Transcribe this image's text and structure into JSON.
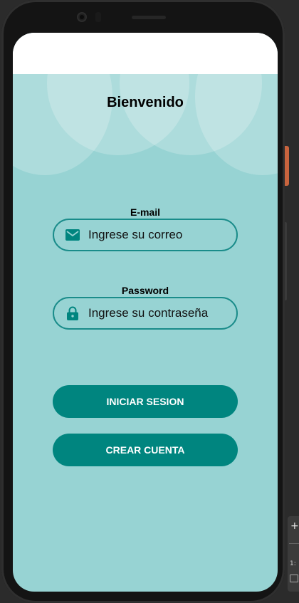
{
  "screen": {
    "title": "Bienvenido",
    "background_color": "#97d3d3",
    "accent_color": "#00857f"
  },
  "email": {
    "label": "E-mail",
    "placeholder": "Ingrese su correo",
    "icon": "mail-icon"
  },
  "password": {
    "label": "Password",
    "placeholder": "Ingrese su contraseña",
    "icon": "lock-icon"
  },
  "buttons": {
    "login_label": "INICIAR SESION",
    "register_label": "CREAR CUENTA"
  },
  "ide_toolbar": {
    "zoom_in": "+",
    "ratio": "1:"
  }
}
